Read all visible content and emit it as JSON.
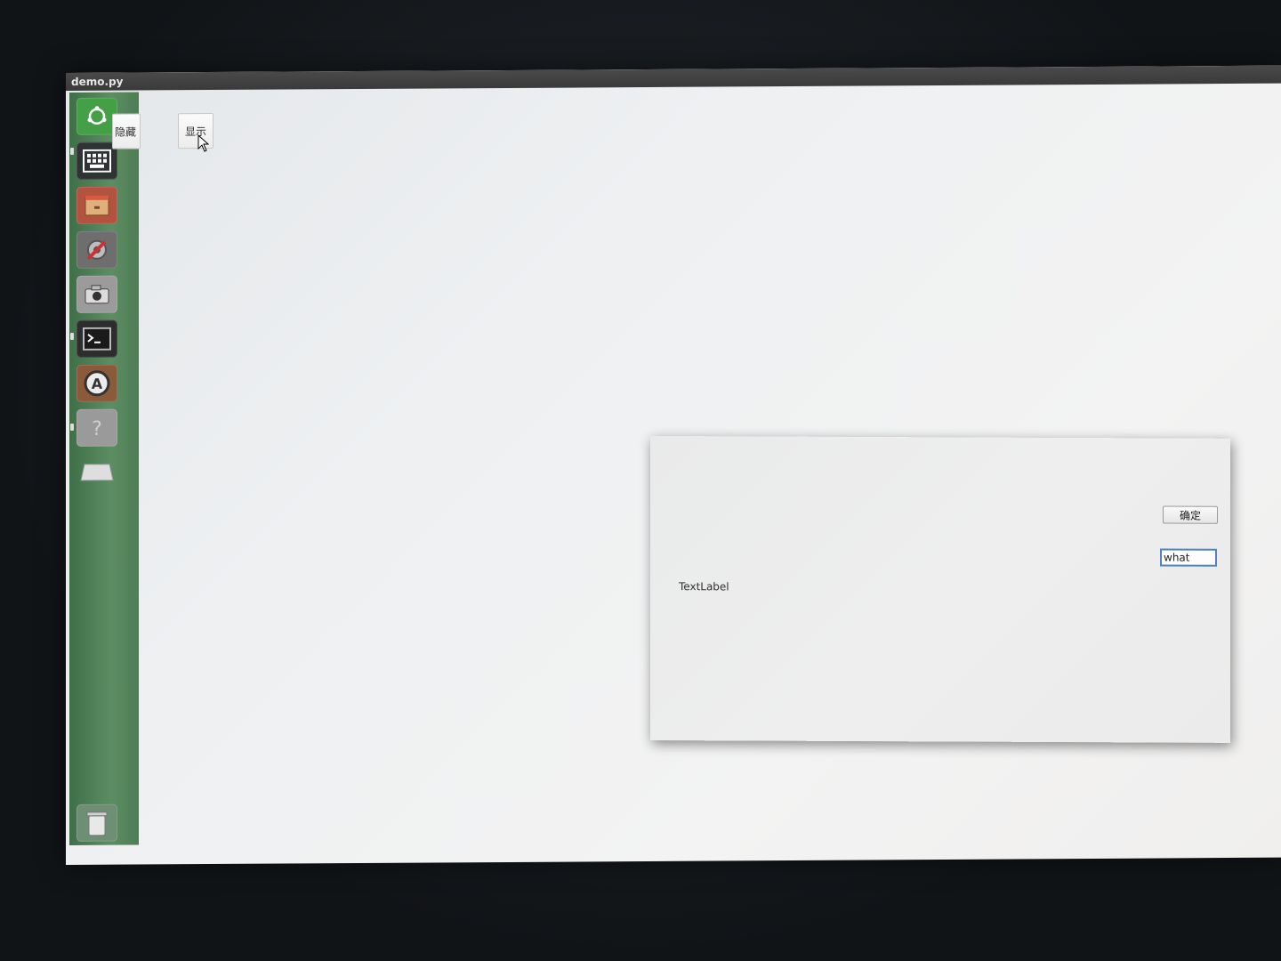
{
  "window": {
    "title": "demo.py"
  },
  "launcher": {
    "items": [
      {
        "icon": "ubuntu-dash-icon",
        "glyph": "◎",
        "color": "#4caf50"
      },
      {
        "icon": "keyboard-icon",
        "glyph": "▦",
        "color": "#3a3a3a"
      },
      {
        "icon": "file-manager-icon",
        "glyph": "▭",
        "color": "#c0614a"
      },
      {
        "icon": "system-settings-icon",
        "glyph": "⚙",
        "color": "#777777"
      },
      {
        "icon": "camera-icon",
        "glyph": "◙",
        "color": "#8c8c8c"
      },
      {
        "icon": "terminal-icon",
        "glyph": ">_",
        "color": "#2e2e2e"
      },
      {
        "icon": "software-center-icon",
        "glyph": "Ⓐ",
        "color": "#8a5a3a"
      },
      {
        "icon": "help-icon",
        "glyph": "?",
        "color": "#9a9a9a"
      },
      {
        "icon": "drive-icon",
        "glyph": "▱",
        "color": "#bdbdbd"
      }
    ],
    "trash_icon": "trash-icon"
  },
  "main": {
    "hide_label": "隐藏",
    "show_label": "显示"
  },
  "dialog": {
    "ok_label": "确定",
    "input_value": "what",
    "text_label": "TextLabel"
  },
  "colors": {
    "launcher_green": "#5d8d63",
    "focus_blue": "#4f83c4"
  }
}
